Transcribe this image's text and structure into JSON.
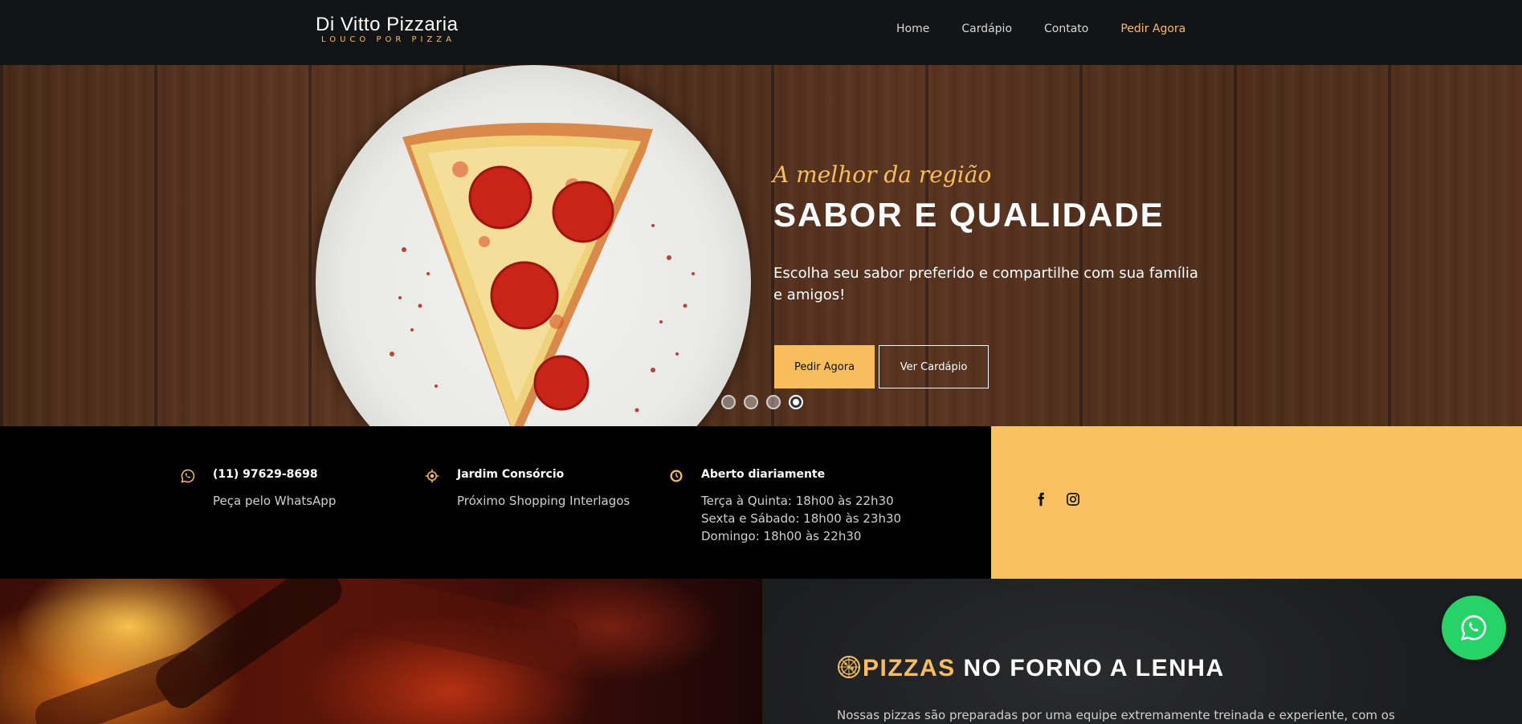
{
  "brand": {
    "name": "Di Vitto Pizzaria",
    "tagline": "LOUCO POR PIZZA"
  },
  "nav": {
    "items": [
      {
        "label": "Home"
      },
      {
        "label": "Cardápio"
      },
      {
        "label": "Contato"
      },
      {
        "label": "Pedir Agora"
      }
    ]
  },
  "hero": {
    "kicker": "A melhor da região",
    "title": "SABOR E QUALIDADE",
    "description": "Escolha seu sabor preferido e compartilhe com sua família e amigos!",
    "primary_button": "Pedir Agora",
    "secondary_button": "Ver Cardápio",
    "slides": 4,
    "active_slide": 4
  },
  "info": {
    "phone": {
      "icon": "whatsapp-icon",
      "title": "(11) 97629-8698",
      "lines": [
        "Peça pelo WhatsApp"
      ]
    },
    "location": {
      "icon": "location-icon",
      "title": "Jardim Consórcio",
      "lines": [
        "Próximo Shopping Interlagos"
      ]
    },
    "hours": {
      "icon": "clock-icon",
      "title": "Aberto diariamente",
      "lines": [
        "Terça à Quinta: 18h00 às 22h30",
        "Sexta e Sábado: 18h00 às 23h30",
        "Domingo: 18h00 às 22h30"
      ]
    }
  },
  "social": {
    "icons": [
      "facebook-icon",
      "instagram-icon"
    ]
  },
  "about": {
    "title_highlight": "PIZZAS",
    "title_rest": " NO FORNO A LENHA",
    "description": "Nossas pizzas são preparadas por uma equipe extremamente treinada e experiente, com os"
  },
  "colors": {
    "accent": "#f9be5c",
    "navbar": "#121416",
    "whatsapp": "#25d366"
  }
}
